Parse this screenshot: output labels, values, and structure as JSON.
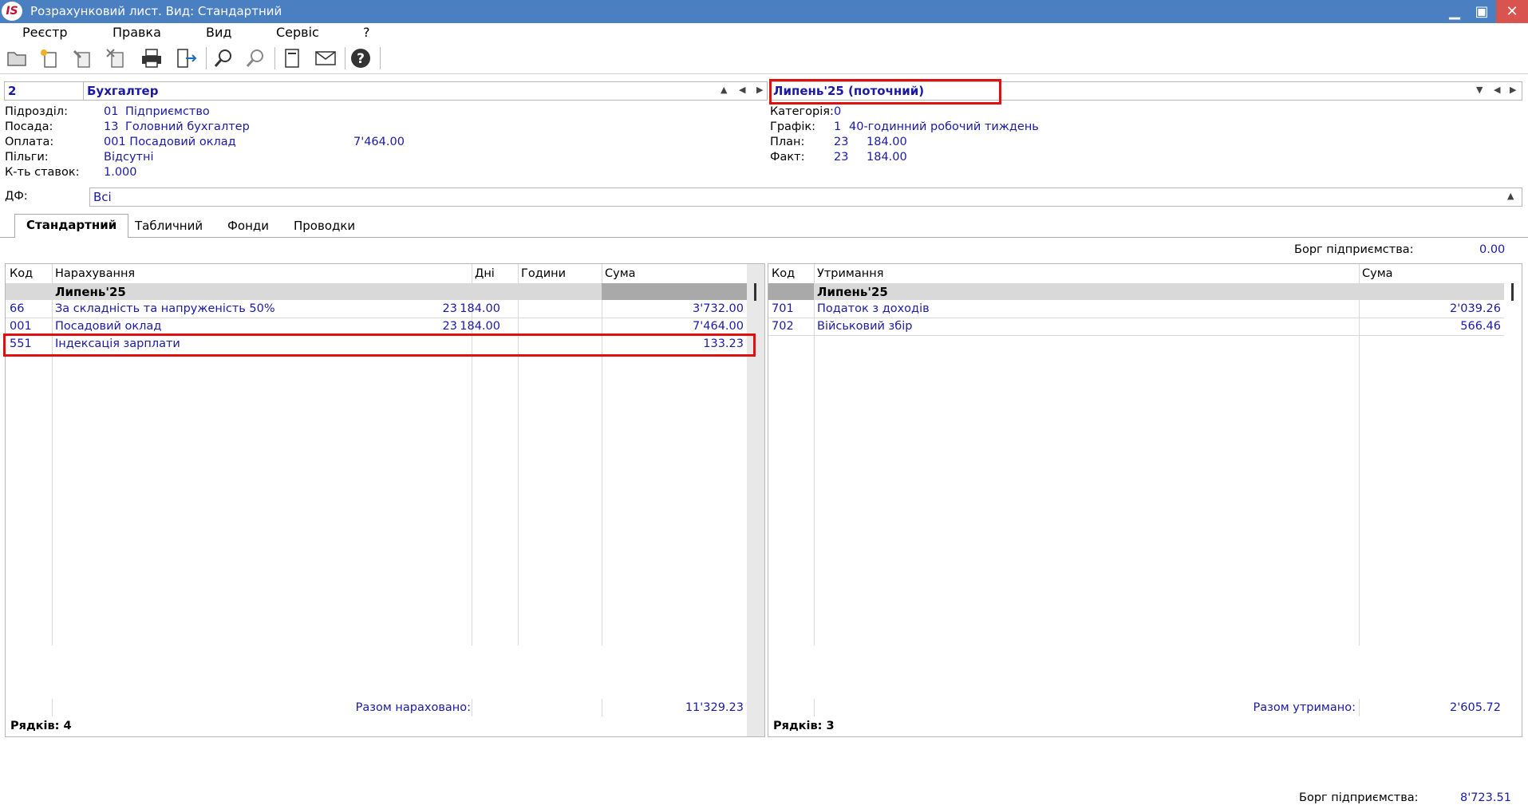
{
  "window": {
    "logo_text": "IS",
    "title": "Розрахунковий лист. Вид: Стандартний"
  },
  "menu": [
    "Реєстр",
    "Правка",
    "Вид",
    "Сервіс",
    "?"
  ],
  "toolbar_icons": [
    "open-folder",
    "new-document",
    "edit-document",
    "delete-document",
    "print",
    "export",
    "search",
    "filter-search",
    "page-setup",
    "email",
    "help"
  ],
  "employee": {
    "number": "2",
    "name": "Бухгалтер",
    "period": "Липень'25 (поточний)"
  },
  "info_left": {
    "subdivision_label": "Підрозділ:",
    "subdivision_code": "01",
    "subdivision_name": "Підприємство",
    "position_label": "Посада:",
    "position_code": "13",
    "position_name": "Головний бухгалтер",
    "payment_label": "Оплата:",
    "payment_value": "001 Посадовий оклад",
    "payment_amount": "7'464.00",
    "benefits_label": "Пільги:",
    "benefits_value": "Відсутні",
    "rates_label": "К-ть ставок:",
    "rates_value": "1.000"
  },
  "info_right": {
    "category_label": "Категорія:",
    "category_value": "0",
    "schedule_label": "Графік:",
    "schedule_code": "1",
    "schedule_name": "40-годинний робочий тиждень",
    "plan_label": "План:",
    "plan_days": "23",
    "plan_hours": "184.00",
    "fact_label": "Факт:",
    "fact_days": "23",
    "fact_hours": "184.00"
  },
  "df": {
    "label": "ДФ:",
    "value": "Всі"
  },
  "tabs": [
    "Стандартний",
    "Табличний",
    "Фонди",
    "Проводки"
  ],
  "debt_top": {
    "label": "Борг підприємства:",
    "value": "0.00"
  },
  "accruals": {
    "headers": [
      "Код",
      "Нарахування",
      "Дні",
      "Години",
      "Сума"
    ],
    "group": "Липень'25",
    "rows": [
      {
        "code": "66",
        "name": "За складність та напруженість 50%",
        "days": "23",
        "hours": "184.00",
        "sum": "3'732.00"
      },
      {
        "code": "001",
        "name": "Посадовий оклад",
        "days": "23",
        "hours": "184.00",
        "sum": "7'464.00"
      },
      {
        "code": "551",
        "name": "Індексація зарплати",
        "days": "",
        "hours": "",
        "sum": "133.23"
      }
    ],
    "total_label": "Разом нараховано:",
    "total_value": "11'329.23",
    "rows_count": "Рядків: 4"
  },
  "deductions": {
    "headers": [
      "Код",
      "Утримання",
      "Сума"
    ],
    "group": "Липень'25",
    "rows": [
      {
        "code": "701",
        "name": "Податок з доходів",
        "sum": "2'039.26"
      },
      {
        "code": "702",
        "name": "Військовий збір",
        "sum": "566.46"
      }
    ],
    "total_label": "Разом утримано:",
    "total_value": "2'605.72",
    "rows_count": "Рядків: 3"
  },
  "debt_bottom": {
    "label": "Борг підприємства:",
    "value": "8'723.51"
  },
  "colors": {
    "titlebar": "#4a7fc1",
    "highlight": "#e01010",
    "link_text": "#1a1aa6"
  }
}
